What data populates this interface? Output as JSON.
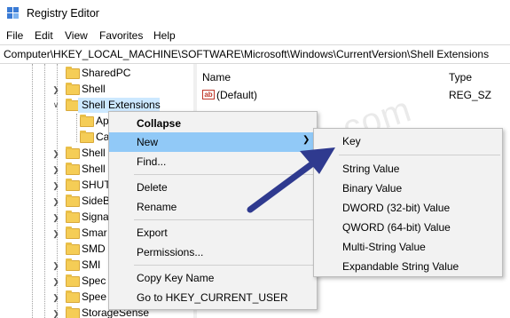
{
  "window": {
    "title": "Registry Editor"
  },
  "menu": [
    "File",
    "Edit",
    "View",
    "Favorites",
    "Help"
  ],
  "address": "Computer\\HKEY_LOCAL_MACHINE\\SOFTWARE\\Microsoft\\Windows\\CurrentVersion\\Shell Extensions",
  "tree": {
    "items": [
      {
        "label": "SharedPC"
      },
      {
        "label": "Shell"
      },
      {
        "label": "Shell Extensions"
      },
      {
        "label": "Ap"
      },
      {
        "label": "Ca"
      },
      {
        "label": "Shell"
      },
      {
        "label": "Shell"
      },
      {
        "label": "SHUT"
      },
      {
        "label": "SideB"
      },
      {
        "label": "Signa"
      },
      {
        "label": "Smar"
      },
      {
        "label": "SMD"
      },
      {
        "label": "SMI"
      },
      {
        "label": "Spec"
      },
      {
        "label": "Spee"
      },
      {
        "label": "StorageSense"
      }
    ]
  },
  "list": {
    "columns": {
      "name": "Name",
      "type": "Type"
    },
    "rows": [
      {
        "name": "(Default)",
        "type": "REG_SZ",
        "icon": "string-value-icon"
      }
    ]
  },
  "context_menu": {
    "items": [
      "Collapse",
      "New",
      "Find...",
      "Delete",
      "Rename",
      "Export",
      "Permissions...",
      "Copy Key Name",
      "Go to HKEY_CURRENT_USER"
    ],
    "highlighted": "New"
  },
  "submenu": {
    "items": [
      "Key",
      "String Value",
      "Binary Value",
      "DWORD (32-bit) Value",
      "QWORD (64-bit) Value",
      "Multi-String Value",
      "Expandable String Value"
    ]
  },
  "watermark": "WindowsLoop.com",
  "colors": {
    "highlight": "#91c9f7",
    "selected": "#cce8ff",
    "arrow": "#2f3a8f",
    "folder": "#f5cd56"
  }
}
